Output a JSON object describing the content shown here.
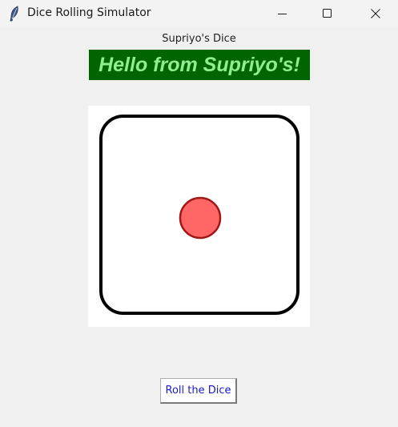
{
  "window": {
    "title": "Dice Rolling Simulator",
    "icon": "feather-icon",
    "controls": [
      "minimize-icon",
      "maximize-icon",
      "close-icon"
    ]
  },
  "app": {
    "subtitle": "Supriyo's Dice",
    "banner": "Hello from Supriyo's!",
    "banner_colors": {
      "background": "#006400",
      "text": "#90ee90"
    }
  },
  "dice": {
    "face_value": 1,
    "pip_color": "#ff6666",
    "pip_outline": "#a01818",
    "face_outline": "#000000"
  },
  "roll_button": {
    "label": "Roll the Dice",
    "text_color": "#1a1acc"
  }
}
